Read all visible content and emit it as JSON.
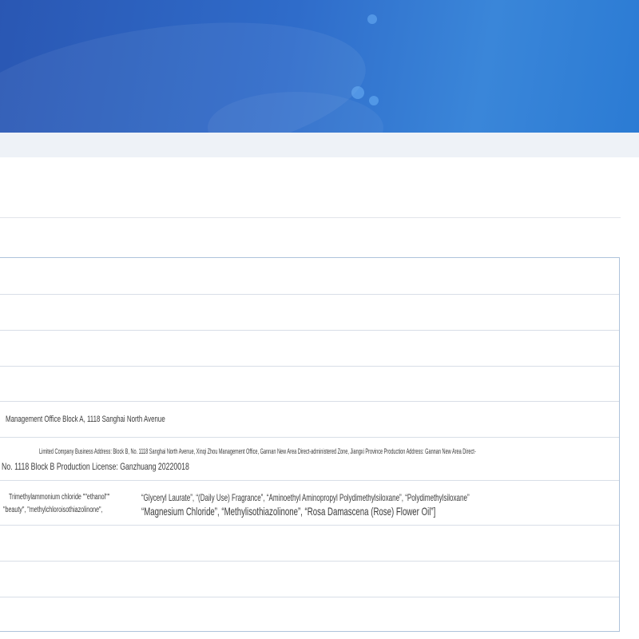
{
  "rows": {
    "management_address": "Management Office Block A, 1118 Sanghai North Avenue",
    "company_address_line1": "Limited Company Business Address: Block B, No. 1118 Sanghai North Avenue, Xinqi Zhou Management Office, Gannan New Area Direct-administered Zone, Jiangxi Province Production Address: Gannan New Area Direct-",
    "company_address_line2": "No. 1118 Block B Production License: Ganzhuang 20220018",
    "ingredients_left_line1": "Trimethylammonium chloride \"\"ethanol\"\"",
    "ingredients_left_line2": "\"beauty\", \"methylchloroisothiazolinone\",",
    "ingredients_right_line1": "“Glyceryl Laurate”, “(Daily Use) Fragrance”, “Aminoethyl Aminopropyl Polydimethylsiloxane”, “Polydimethylsiloxane”",
    "ingredients_right_line2": "“Magnesium Chloride”, “Methylisothiazolinone”, “Rosa Damascena (Rose) Flower Oil”]"
  },
  "colors": {
    "banner_start": "#2a57b3",
    "banner_end": "#2b7bd4",
    "table_border": "#aec3db",
    "greybar": "#eef2f7"
  }
}
